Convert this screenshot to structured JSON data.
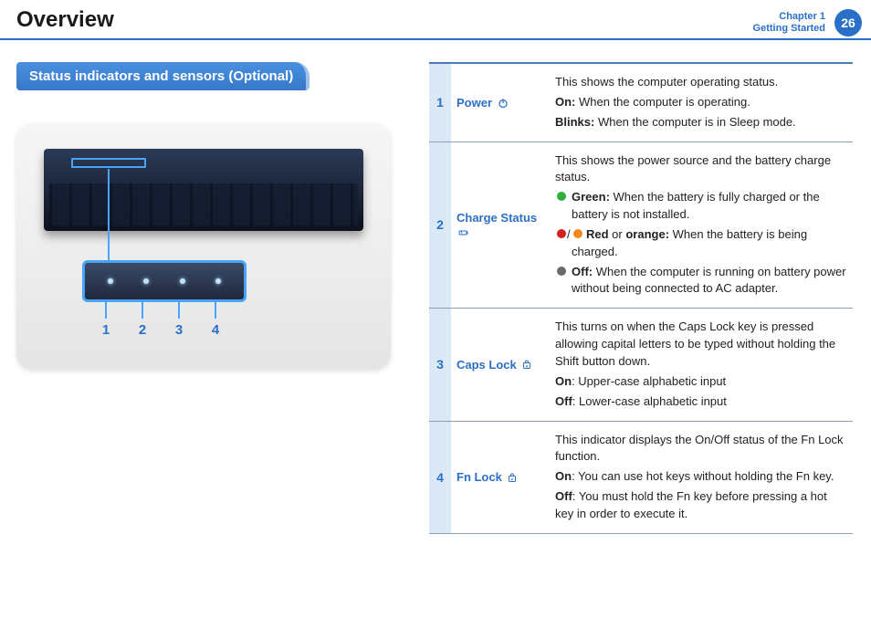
{
  "header": {
    "title": "Overview",
    "chapter_line1": "Chapter 1",
    "chapter_line2": "Getting Started",
    "page_number": "26"
  },
  "section": {
    "heading": "Status indicators and sensors (Optional)"
  },
  "figure": {
    "labels": [
      "1",
      "2",
      "3",
      "4"
    ]
  },
  "table": {
    "rows": [
      {
        "num": "1",
        "name": "Power",
        "icon": "power-icon",
        "desc": {
          "intro": "This shows the computer operating status.",
          "on_label": "On:",
          "on_text": " When the computer is operating.",
          "blinks_label": "Blinks:",
          "blinks_text": " When the computer is in Sleep mode."
        }
      },
      {
        "num": "2",
        "name": "Charge Status",
        "icon": "charge-icon",
        "desc": {
          "intro": "This shows the power source and the battery charge status.",
          "green_label": "Green:",
          "green_text": " When the battery is fully charged or the battery is not installed.",
          "redorange_label_red": "Red",
          "redorange_or": " or ",
          "redorange_label_orange": "orange:",
          "redorange_text": " When the battery is being charged.",
          "off_label": "Off:",
          "off_text": " When the computer is running on battery power without being connected to AC adapter."
        }
      },
      {
        "num": "3",
        "name": "Caps Lock",
        "icon": "capslock-icon",
        "desc": {
          "intro": "This turns on when the Caps Lock key is pressed allowing capital letters to be typed without holding the Shift button down.",
          "on_label": "On",
          "on_text": ": Upper-case alphabetic input",
          "off_label": "Off",
          "off_text": ": Lower-case alphabetic input"
        }
      },
      {
        "num": "4",
        "name": "Fn Lock",
        "icon": "fnlock-icon",
        "desc": {
          "intro": "This indicator displays the On/Off status of the Fn Lock function.",
          "on_label": "On",
          "on_text": ": You can use hot keys without holding the Fn key.",
          "off_label": "Off",
          "off_text": ": You must hold the Fn key before pressing a hot key in order to execute it."
        }
      }
    ]
  }
}
